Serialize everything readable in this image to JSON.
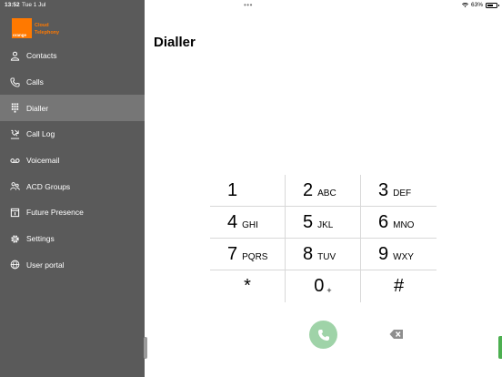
{
  "status_bar": {
    "time": "13:52",
    "date": "Tue 1 Jul",
    "battery": "63%",
    "battery_level": 0.63,
    "multitask": "•••"
  },
  "logo": {
    "brand": "orange",
    "product_line1": "Cloud",
    "product_line2": "Telephony",
    "color": "#ff7900"
  },
  "sidebar": {
    "items": [
      {
        "label": "Contacts",
        "icon": "person-icon"
      },
      {
        "label": "Calls",
        "icon": "phone-icon"
      },
      {
        "label": "Dialler",
        "icon": "keypad-icon",
        "active": true
      },
      {
        "label": "Call Log",
        "icon": "call-log-icon"
      },
      {
        "label": "Voicemail",
        "icon": "voicemail-icon"
      },
      {
        "label": "ACD Groups",
        "icon": "group-icon"
      },
      {
        "label": "Future Presence",
        "icon": "calendar-icon"
      },
      {
        "label": "Settings",
        "icon": "gear-icon"
      },
      {
        "label": "User portal",
        "icon": "globe-icon"
      }
    ]
  },
  "main": {
    "title": "Dialler"
  },
  "keypad": {
    "rows": [
      [
        {
          "digit": "1",
          "letters": ""
        },
        {
          "digit": "2",
          "letters": "ABC"
        },
        {
          "digit": "3",
          "letters": "DEF"
        }
      ],
      [
        {
          "digit": "4",
          "letters": "GHI"
        },
        {
          "digit": "5",
          "letters": "JKL"
        },
        {
          "digit": "6",
          "letters": "MNO"
        }
      ],
      [
        {
          "digit": "7",
          "letters": "PQRS"
        },
        {
          "digit": "8",
          "letters": "TUV"
        },
        {
          "digit": "9",
          "letters": "WXY"
        }
      ],
      [
        {
          "digit": "*",
          "letters": ""
        },
        {
          "digit": "0",
          "letters": "+"
        },
        {
          "digit": "#",
          "letters": ""
        }
      ]
    ]
  },
  "colors": {
    "sidebar_bg": "#5a5a5a",
    "active_bg": "#767676",
    "call_button": "#9fd3a8",
    "accent_green": "#4caf50"
  }
}
